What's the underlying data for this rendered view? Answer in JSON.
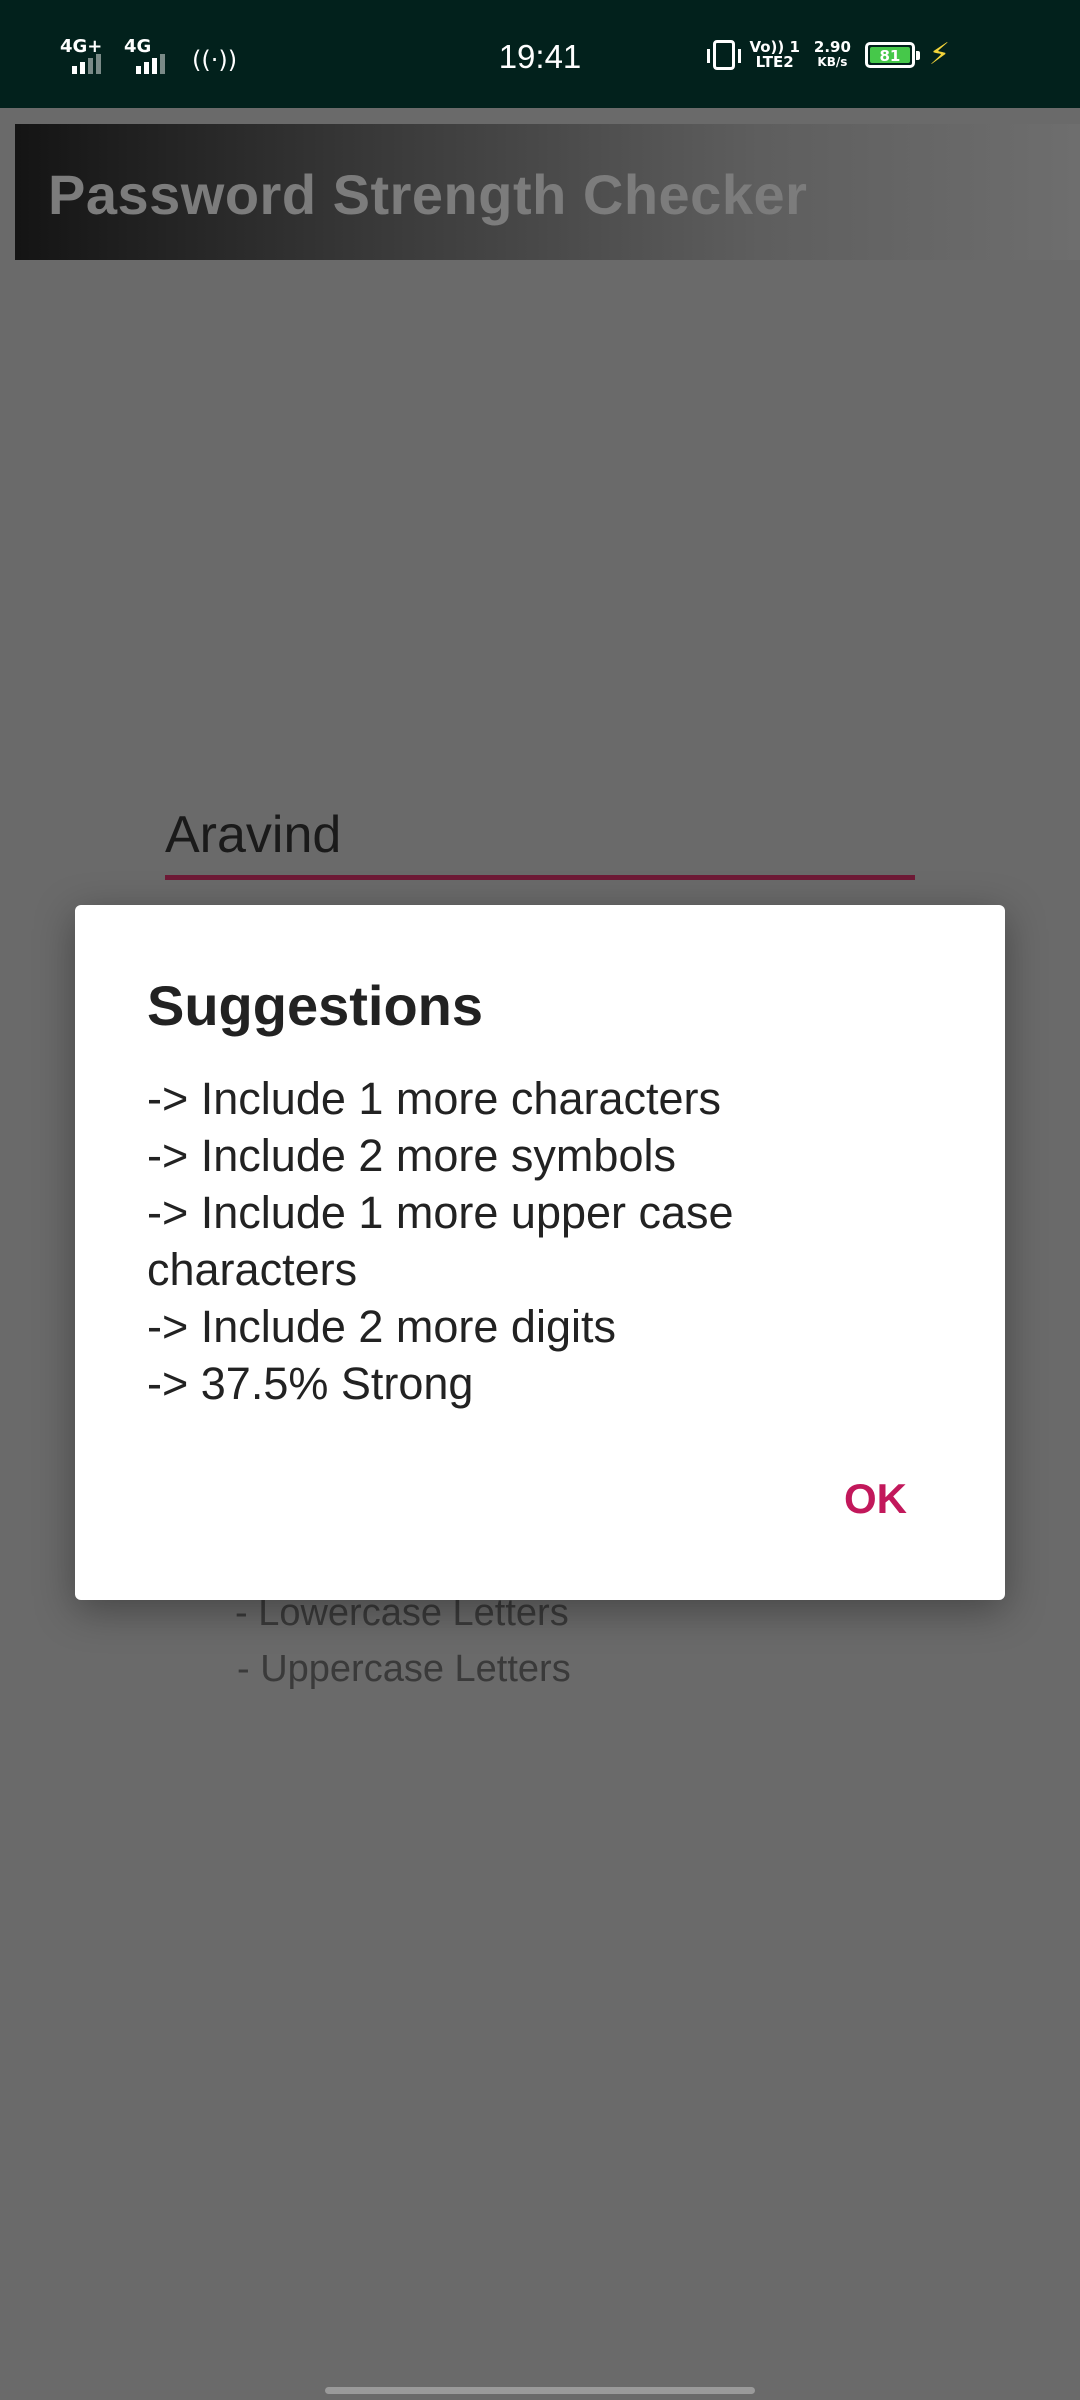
{
  "status_bar": {
    "network_1": "4G+",
    "network_2": "4G",
    "time": "19:41",
    "volte_line1": "Vo)) 1",
    "volte_line2": "LTE2",
    "speed_value": "2.90",
    "speed_unit": "KB/s",
    "battery_level": "81",
    "icons": [
      "signal-icon",
      "hotspot-icon",
      "vibrate-icon",
      "battery-icon",
      "charging-icon"
    ]
  },
  "app_bar": {
    "title": "Password Strength Checker"
  },
  "main": {
    "password_value": "Aravind",
    "requirements": [
      "- Lowercase Letters",
      "- Uppercase Letters"
    ]
  },
  "dialog": {
    "title": "Suggestions",
    "lines": [
      "-> Include 1 more characters",
      "-> Include 2 more symbols",
      "-> Include 1 more upper case characters",
      "-> Include 2 more digits",
      "-> 37.5% Strong"
    ],
    "ok_label": "OK"
  },
  "colors": {
    "status_bar_bg": "#02211c",
    "accent": "#c2185b",
    "input_underline": "#6e1a36",
    "scrim": "#6a6a6a"
  }
}
